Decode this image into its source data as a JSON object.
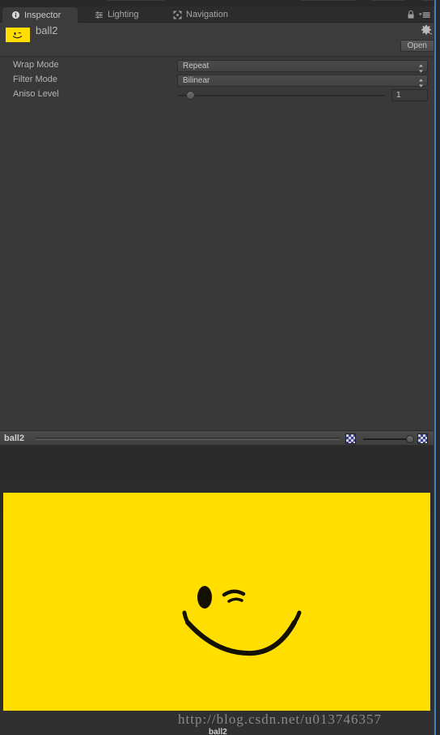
{
  "window": {
    "focus_border_color": "#3d7fc4",
    "background_color": "#393939"
  },
  "tabs": [
    {
      "label": "Inspector",
      "icon": "info-circle-icon",
      "active": true
    },
    {
      "label": "Lighting",
      "icon": "lighting-sliders-icon",
      "active": false
    },
    {
      "label": "Navigation",
      "icon": "navigation-arrows-icon",
      "active": false
    }
  ],
  "tabbar_controls": {
    "lock_icon": "lock-icon",
    "menu_icon": "hamburger-menu-icon"
  },
  "header": {
    "asset_name": "ball2",
    "thumbnail_color": "#FFDE00",
    "gear_icon": "gear-icon",
    "open_label": "Open"
  },
  "properties": [
    {
      "label": "Wrap Mode",
      "type": "dropdown",
      "value": "Repeat",
      "name": "wrap-mode"
    },
    {
      "label": "Filter Mode",
      "type": "dropdown",
      "value": "Bilinear",
      "name": "filter-mode"
    },
    {
      "label": "Aniso Level",
      "type": "slider",
      "value": "1",
      "slider_percent": 7,
      "name": "aniso-level"
    }
  ],
  "preview": {
    "title": "ball2",
    "rgb_toggle_icon": "rgb-checker-icon",
    "alpha_toggle_icon": "alpha-checker-icon",
    "mip_slider_percent": 88,
    "texture_color": "#FFDE00",
    "texture_content": "winking-smiley-face"
  },
  "watermark": {
    "url": "http://blog.csdn.net/u013746357"
  },
  "bottom_status": {
    "label": "ball2"
  }
}
